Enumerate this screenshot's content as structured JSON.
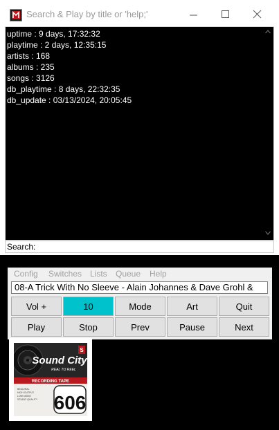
{
  "window": {
    "title": "Search & Play by title or 'help;'",
    "icon": "app-logo-icon"
  },
  "output": {
    "lines": [
      "uptime : 9 days, 17:32:32",
      "playtime : 2 days, 12:35:15",
      "artists : 168",
      "albums : 235",
      "songs : 3126",
      "db_playtime : 8 days, 22:32:35",
      "db_update : 03/13/2024, 20:05:45"
    ]
  },
  "search": {
    "label": "Search:",
    "value": ""
  },
  "player": {
    "menu": [
      "Config",
      "Switches",
      "Lists",
      "Queue",
      "Help"
    ],
    "now_playing": "08-A Trick With No Sleeve - Alain Johannes & Dave Grohl &",
    "buttons_row1": [
      "Vol +",
      "10",
      "Mode",
      "Art",
      "Quit"
    ],
    "buttons_row2": [
      "Play",
      "Stop",
      "Prev",
      "Pause",
      "Next"
    ],
    "volume_active_color": "#00c2cc"
  },
  "album_art": {
    "title": "Sound City",
    "subtitle": "REAL TO REEL",
    "band": "RECORDING TAPE",
    "number": "606",
    "label": "S",
    "fine_print": [
      "BINAURAL",
      "HIGH OUTPUT",
      "LOW NOISE",
      "STUDIO QUALITY"
    ]
  }
}
